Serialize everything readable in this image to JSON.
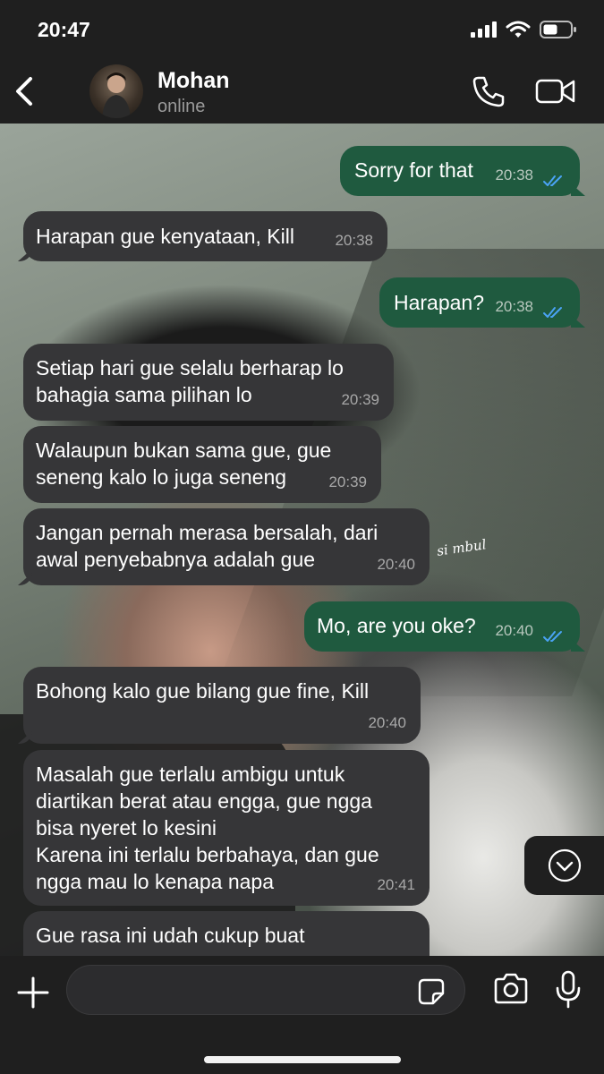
{
  "status_bar": {
    "time": "20:47"
  },
  "header": {
    "contact_name": "Mohan",
    "contact_status": "online"
  },
  "wallpaper": {
    "signature": "si mbul"
  },
  "messages": [
    {
      "direction": "out",
      "text": "Sorry for that",
      "time": "20:38",
      "read": true
    },
    {
      "direction": "in",
      "text": "Harapan gue kenyataan, Kill",
      "time": "20:38"
    },
    {
      "direction": "out",
      "text": "Harapan?",
      "time": "20:38",
      "read": true
    },
    {
      "direction": "in",
      "text": "Setiap hari gue selalu berharap lo\nbahagia sama pilihan lo",
      "time": "20:39"
    },
    {
      "direction": "in",
      "text": "Walaupun bukan sama gue, gue\nseneng kalo lo juga seneng",
      "time": "20:39"
    },
    {
      "direction": "in",
      "text": "Jangan pernah merasa bersalah, dari\nawal penyebabnya adalah gue",
      "time": "20:40"
    },
    {
      "direction": "out",
      "text": "Mo, are you oke?",
      "time": "20:40",
      "read": true
    },
    {
      "direction": "in",
      "text": "Bohong kalo gue bilang gue fine, Kill",
      "time": "20:40"
    },
    {
      "direction": "in",
      "text": "Masalah gue terlalu ambigu untuk\ndiartikan berat atau engga, gue ngga\nbisa nyeret lo kesini\nKarena ini terlalu berbahaya, dan gue\nngga mau lo kenapa napa",
      "time": "20:41"
    },
    {
      "direction": "in",
      "text": "Gue rasa ini udah cukup buat",
      "time": ""
    }
  ],
  "composer": {
    "value": "",
    "placeholder": ""
  },
  "colors": {
    "incoming_bubble": "#363638",
    "outgoing_bubble": "#1f5a3f",
    "read_ticks": "#4aa3f5",
    "bar_background": "#1f1f1f"
  }
}
